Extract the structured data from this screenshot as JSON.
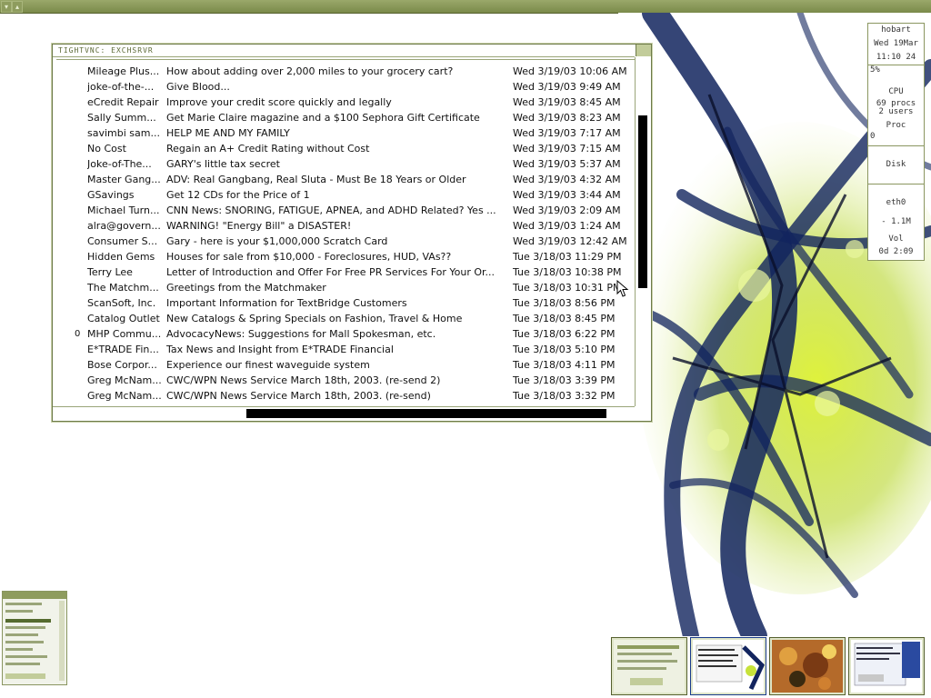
{
  "window": {
    "title": "TIGHTVNC: EXCHSRVR"
  },
  "messages": [
    {
      "flag": "",
      "sender": "Mileage Plus...",
      "subject": "How about adding over 2,000 miles to your grocery cart?",
      "date": "Wed 3/19/03 10:06 AM"
    },
    {
      "flag": "",
      "sender": "joke-of-the-...",
      "subject": "Give Blood...",
      "date": "Wed 3/19/03 9:49 AM"
    },
    {
      "flag": "",
      "sender": "eCredit Repair",
      "subject": "Improve your credit score quickly and legally",
      "date": "Wed 3/19/03 8:45 AM"
    },
    {
      "flag": "",
      "sender": "Sally Summ...",
      "subject": "Get Marie Claire magazine and a $100 Sephora Gift Certificate",
      "date": "Wed 3/19/03 8:23 AM"
    },
    {
      "flag": "",
      "sender": "savimbi sam...",
      "subject": "HELP ME AND MY FAMILY",
      "date": "Wed 3/19/03 7:17 AM"
    },
    {
      "flag": "",
      "sender": "No Cost",
      "subject": "Regain an A+ Credit Rating without Cost",
      "date": "Wed 3/19/03 7:15 AM"
    },
    {
      "flag": "",
      "sender": "Joke-of-The...",
      "subject": "GARY's little tax secret",
      "date": "Wed 3/19/03 5:37 AM"
    },
    {
      "flag": "",
      "sender": "Master Gang...",
      "subject": "ADV: Real Gangbang, Real Sluta -  Must Be 18 Years or Older",
      "date": "Wed 3/19/03 4:32 AM"
    },
    {
      "flag": "",
      "sender": "GSavings",
      "subject": "Get 12 CDs for the Price of 1",
      "date": "Wed 3/19/03 3:44 AM"
    },
    {
      "flag": "",
      "sender": "Michael Turn...",
      "subject": "CNN News:  SNORING,  FATIGUE,  APNEA,  and  ADHD  Related? Yes ...",
      "date": "Wed 3/19/03 2:09 AM"
    },
    {
      "flag": "",
      "sender": "alra@govern...",
      "subject": "WARNING!  \"Energy Bill\" a DISASTER!",
      "date": "Wed 3/19/03 1:24 AM"
    },
    {
      "flag": "",
      "sender": "Consumer S...",
      "subject": "Gary - here is your $1,000,000 Scratch Card",
      "date": "Wed 3/19/03 12:42 AM"
    },
    {
      "flag": "",
      "sender": "Hidden Gems",
      "subject": "Houses for sale from $10,000 - Foreclosures, HUD, VAs??",
      "date": "Tue 3/18/03 11:29 PM"
    },
    {
      "flag": "",
      "sender": "Terry Lee",
      "subject": "Letter of Introduction and Offer For Free PR Services For Your Or...",
      "date": "Tue 3/18/03 10:38 PM"
    },
    {
      "flag": "",
      "sender": "The Matchm...",
      "subject": "Greetings from the Matchmaker",
      "date": "Tue 3/18/03 10:31 PM"
    },
    {
      "flag": "",
      "sender": "ScanSoft, Inc.",
      "subject": "Important Information for TextBridge Customers",
      "date": "Tue 3/18/03 8:56 PM"
    },
    {
      "flag": "",
      "sender": "Catalog Outlet",
      "subject": "New Catalogs & Spring Specials on Fashion, Travel & Home",
      "date": "Tue 3/18/03 8:45 PM"
    },
    {
      "flag": "0",
      "sender": "MHP Commu...",
      "subject": "AdvocacyNews: Suggestions for Mall Spokesman, etc.",
      "date": "Tue 3/18/03 6:22 PM"
    },
    {
      "flag": "",
      "sender": "E*TRADE Fin...",
      "subject": "Tax News and Insight from E*TRADE Financial",
      "date": "Tue 3/18/03 5:10 PM"
    },
    {
      "flag": "",
      "sender": "Bose Corpor...",
      "subject": "Experience our finest waveguide system",
      "date": "Tue 3/18/03 4:11 PM"
    },
    {
      "flag": "",
      "sender": "Greg McNam...",
      "subject": "CWC/WPN News Service March 18th, 2003. (re-send 2)",
      "date": "Tue 3/18/03 3:39 PM"
    },
    {
      "flag": "",
      "sender": "Greg McNam...",
      "subject": "CWC/WPN News Service March 18th, 2003. (re-send)",
      "date": "Tue 3/18/03 3:32 PM"
    }
  ],
  "sysmon": {
    "host": "hobart",
    "date": "Wed 19Mar",
    "time": "11:10 24",
    "cpu_pct": "5%",
    "cpu_label": "CPU",
    "procs": "69 procs",
    "users": "2 users",
    "proc_label": "Proc",
    "proc_zero": "0",
    "disk_label": "Disk",
    "net_label": "eth0",
    "net_value": "- 1.1M",
    "vol_label": "Vol",
    "uptime": "0d  2:09"
  },
  "colors": {
    "panel": "#7a8a4a",
    "border": "#6d7a49",
    "scroll_thumb": "#000000"
  }
}
